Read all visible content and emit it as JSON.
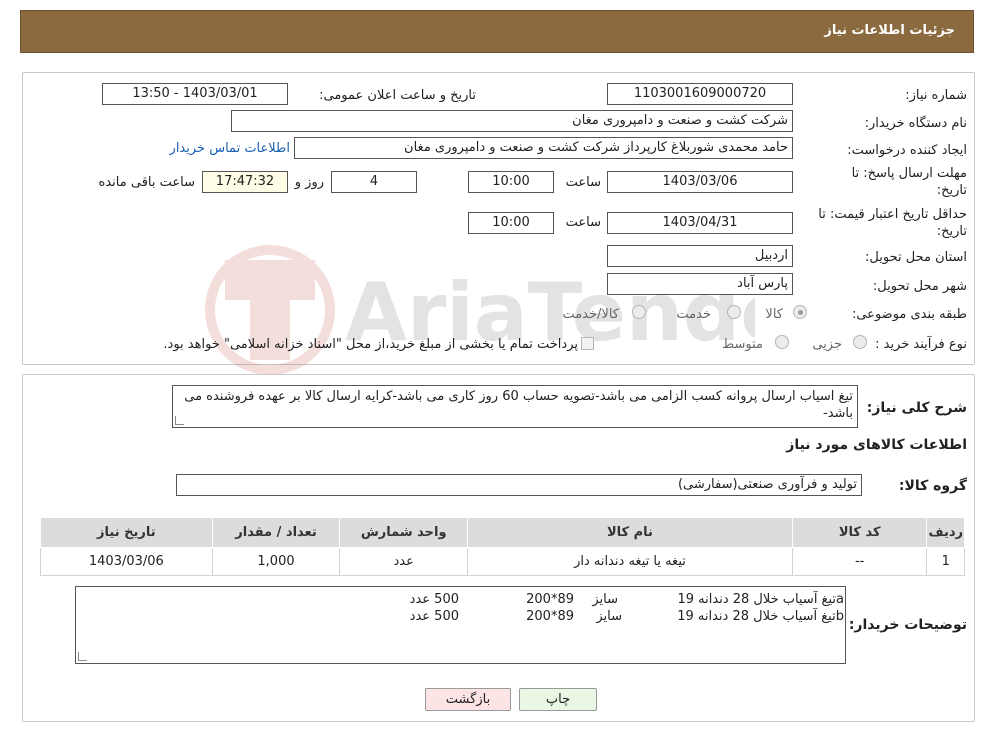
{
  "header": {
    "title": "جزئیات اطلاعات نیاز"
  },
  "form": {
    "need_number_label": "شماره نیاز:",
    "need_number": "1103001609000720",
    "announce_label": "تاریخ و ساعت اعلان عمومی:",
    "announce_value": "1403/03/01 - 13:50",
    "buyer_org_label": "نام دستگاه خریدار:",
    "buyer_org": "شرکت کشت و صنعت و دامپروری مغان",
    "requester_label": "ایجاد کننده درخواست:",
    "requester": "حامد محمدی شوربلاغ کارپرداز شرکت کشت و صنعت و دامپروری مغان",
    "contact_link": "اطلاعات تماس خریدار",
    "deadline_label_1": "مهلت ارسال پاسخ: تا",
    "deadline_label_2": "تاریخ:",
    "deadline_date": "1403/03/06",
    "time_label": "ساعت",
    "deadline_time": "10:00",
    "days_value": "4",
    "days_label": "روز و",
    "remaining_time": "17:47:32",
    "remaining_label": "ساعت باقی مانده",
    "validity_label_1": "حداقل تاریخ اعتبار قیمت: تا",
    "validity_label_2": "تاریخ:",
    "validity_date": "1403/04/31",
    "validity_time_label": "ساعت",
    "validity_time": "10:00",
    "province_label": "استان محل تحویل:",
    "province": "اردبیل",
    "city_label": "شهر محل تحویل:",
    "city": "پارس آباد",
    "category_label": "طبقه بندی موضوعی:",
    "category_options": [
      "کالا",
      "خدمت",
      "کالا/خدمت"
    ],
    "process_label": "نوع فرآیند خرید :",
    "process_options": [
      "جزیی",
      "متوسط"
    ],
    "process_note": "پرداخت تمام یا بخشی از مبلغ خرید،از محل \"اسناد خزانه اسلامی\" خواهد بود."
  },
  "description": {
    "label": "شرح کلی نیاز:",
    "text": "تیغ اسیاب ارسال پروانه کسب الزامی می باشد-تصویه حساب 60 روز کاری می باشد-کرایه ارسال کالا بر عهده فروشنده می باشد-"
  },
  "goods": {
    "section_title": "اطلاعات کالاهای مورد نیاز",
    "group_label": "گروه کالا:",
    "group_value": "تولید و فرآوری صنعتی(سفارشی)",
    "columns": [
      "ردیف",
      "کد کالا",
      "نام کالا",
      "واحد شمارش",
      "تعداد / مقدار",
      "تاریخ نیاز"
    ],
    "rows": [
      [
        "1",
        "--",
        "تیغه یا تیغه دندانه دار",
        "عدد",
        "1,000",
        "1403/03/06"
      ]
    ]
  },
  "buyer_notes": {
    "label": "توضیحات خریدار:",
    "lines": [
      {
        "name": "aتیغ آسیاب خلال 28 دندانه 19",
        "size_label": "سایز",
        "size": "200*89",
        "qty": "500 عدد"
      },
      {
        "name": "bتیغ آسیاب خلال 28 دندانه 19",
        "size_label": "سایز",
        "size": "200*89",
        "qty": "500 عدد"
      }
    ]
  },
  "buttons": {
    "print": "چاپ",
    "back": "بازگشت"
  },
  "colors": {
    "header_bg": "#8c6a3f",
    "print_bg": "#eaf7e4",
    "back_bg": "#fde4e4",
    "link": "#1a5fb4"
  }
}
